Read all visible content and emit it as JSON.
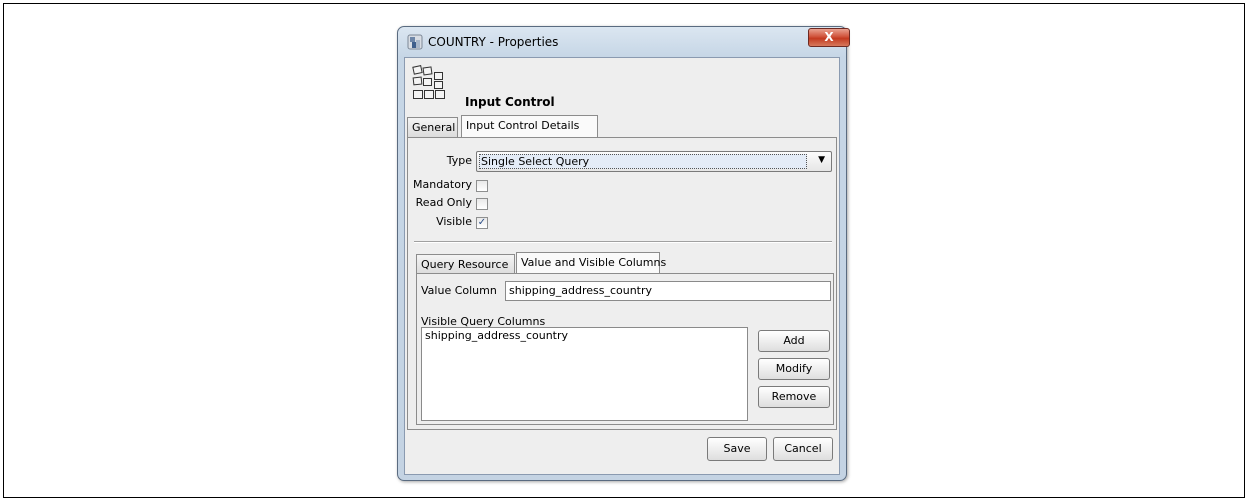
{
  "window": {
    "title": "COUNTRY - Properties",
    "close_label": "X",
    "header_title": "Input Control"
  },
  "tabs": [
    {
      "label": "General",
      "active": false
    },
    {
      "label": "Input Control Details",
      "active": true
    }
  ],
  "fields": {
    "type_label": "Type",
    "type_value": "Single Select Query",
    "mandatory_label": "Mandatory",
    "mandatory_checked": false,
    "read_only_label": "Read Only",
    "read_only_checked": false,
    "visible_label": "Visible",
    "visible_checked": true
  },
  "subtabs": [
    {
      "label": "Query Resource",
      "active": false
    },
    {
      "label": "Value and Visible Columns",
      "active": true
    }
  ],
  "value_column": {
    "label": "Value Column",
    "value": "shipping_address_country"
  },
  "visible_columns": {
    "label": "Visible Query Columns",
    "items": [
      "shipping_address_country"
    ]
  },
  "buttons": {
    "add": "Add",
    "modify": "Modify",
    "remove": "Remove",
    "save": "Save",
    "cancel": "Cancel"
  },
  "colors": {
    "title_bar": "#c6d6e6",
    "close_button": "#c33a20",
    "selection": "#e4ecf7"
  }
}
